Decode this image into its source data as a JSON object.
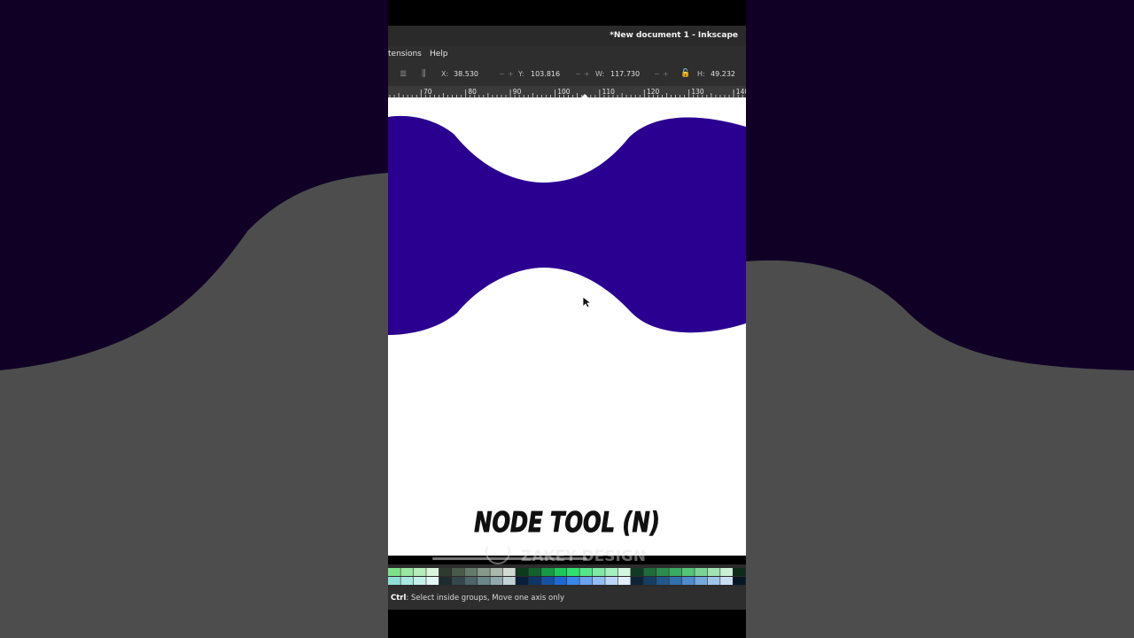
{
  "window": {
    "title": "*New document 1 - Inkscape"
  },
  "menu": {
    "items": [
      "tensions",
      "Help"
    ]
  },
  "toolbar": {
    "x_label": "X:",
    "x_value": "38.530",
    "y_label": "Y:",
    "y_value": "103.816",
    "w_label": "W:",
    "w_value": "117.730",
    "h_label": "H:",
    "h_value": "49.232",
    "minus": "−",
    "plus": "+",
    "lock_icon": "🔓"
  },
  "ruler": {
    "ticks": [
      "70",
      "80",
      "90",
      "100",
      "110",
      "120",
      "130",
      "140"
    ]
  },
  "caption": "NODE TOOL (N)",
  "watermark": "ZAKEY DESIGN",
  "statusbar": {
    "modifier": "Ctrl",
    "text": ": Select inside groups, Move one axis only"
  },
  "colors": {
    "shape": "#2a0090",
    "bg_dark": "#110026",
    "bg_grey": "#4d4d4d"
  },
  "icons": [
    "align-icon",
    "distribute-icon",
    "lock-icon",
    "mouse-cursor-icon"
  ]
}
